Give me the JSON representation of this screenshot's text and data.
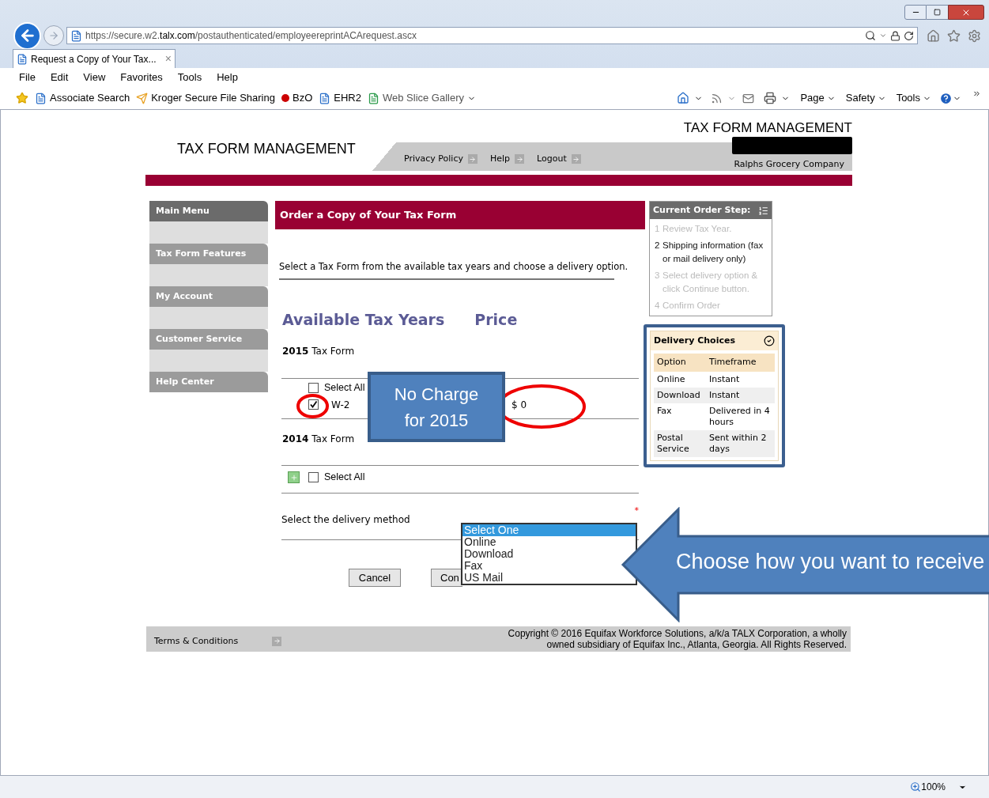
{
  "browser": {
    "address": "https://secure.w2.**talx.com**/postauthenticated/employeereprintACArequest.ascx",
    "tab": {
      "title": "Request a Copy of Your Tax...",
      "close": "×"
    },
    "menu": [
      "File",
      "Edit",
      "View",
      "Favorites",
      "Tools",
      "Help"
    ],
    "favorites": [
      {
        "label": "Associate Search",
        "kind": "page"
      },
      {
        "label": "Kroger Secure File Sharing",
        "kind": "arrow"
      },
      {
        "label": "BzO",
        "kind": "alert"
      },
      {
        "label": "EHR2",
        "kind": "page"
      },
      {
        "label": "Web Slice Gallery",
        "kind": "gallery"
      }
    ],
    "commands": [
      "Page",
      "Safety",
      "Tools"
    ],
    "zoom": "100%"
  },
  "header": {
    "title_right": "TAX FORM MANAGEMENT",
    "title_left": "TAX FORM MANAGEMENT",
    "links": [
      "Privacy Policy",
      "Help",
      "Logout"
    ],
    "company": "Ralphs Grocery Company"
  },
  "sidebar": {
    "items": [
      {
        "label": "Main Menu",
        "selected": true
      },
      {
        "label": "Tax Form Features",
        "selected": false
      },
      {
        "label": "My Account",
        "selected": false
      },
      {
        "label": "Customer Service",
        "selected": false
      },
      {
        "label": "Help Center",
        "selected": false
      }
    ]
  },
  "main": {
    "title": "Order a Copy of Your Tax Form",
    "intro": "Select a Tax Form from the available tax years and choose a delivery option.",
    "heading_years": "Available Tax Years",
    "heading_price": "Price",
    "years": [
      {
        "year": "2015",
        "label": "Tax Form",
        "select_all": {
          "label": "Select All",
          "checked": false
        },
        "forms": [
          {
            "name": "W-2",
            "checked": true,
            "price": "$ 0"
          }
        ]
      },
      {
        "year": "2014",
        "label": "Tax Form",
        "select_all": {
          "label": "Select All",
          "checked": false
        }
      }
    ],
    "delivery": {
      "label": "Select the delivery method",
      "required": "*",
      "options": [
        {
          "label": "Select One",
          "selected": true
        },
        {
          "label": "Online",
          "selected": false
        },
        {
          "label": "Download",
          "selected": false
        },
        {
          "label": "Fax",
          "selected": false
        },
        {
          "label": "US Mail",
          "selected": false
        }
      ]
    },
    "buttons": {
      "cancel": "Cancel",
      "continue": "Con"
    }
  },
  "order_steps": {
    "title": "Current Order Step:",
    "steps": [
      {
        "number": "1",
        "text": "Review Tax Year.",
        "current": false
      },
      {
        "number": "2",
        "text": "Shipping information (fax or mail delivery only)",
        "current": true
      },
      {
        "number": "3",
        "text": "Select delivery option & click Continue button.",
        "current": false
      },
      {
        "number": "4",
        "text": "Confirm Order",
        "current": false
      }
    ]
  },
  "delivery_choices": {
    "title": "Delivery Choices",
    "header": [
      "Option",
      "Timeframe"
    ],
    "rows": [
      [
        "Online",
        "Instant"
      ],
      [
        "Download",
        "Instant"
      ],
      [
        "Fax",
        "Delivered in 4 hours"
      ],
      [
        "Postal Service",
        "Sent within 2 days"
      ]
    ]
  },
  "footer": {
    "terms": "Terms & Conditions",
    "copyright": "Copyright © 2016  Equifax Workforce Solutions, a/k/a TALX Corporation, a wholly owned subsidiary of Equifax Inc., Atlanta, Georgia.  All Rights Reserved."
  },
  "annotations": {
    "callout": "No Charge for 2015",
    "arrow": "Choose how you want to receive"
  }
}
